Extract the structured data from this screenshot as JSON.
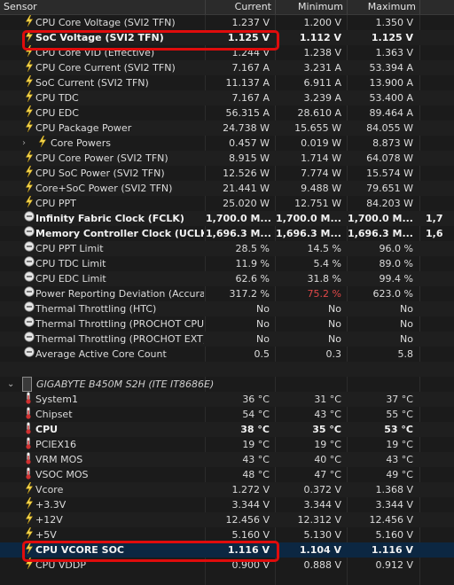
{
  "header": {
    "sensor": "Sensor",
    "current": "Current",
    "minimum": "Minimum",
    "maximum": "Maximum"
  },
  "rows1": [
    {
      "name": "CPU Core Voltage (SVI2 TFN)",
      "cur": "1.237 V",
      "min": "1.200 V",
      "max": "1.350 V",
      "icon": "bolt-icon"
    },
    {
      "name": "SoC Voltage (SVI2 TFN)",
      "cur": "1.125 V",
      "min": "1.112 V",
      "max": "1.125 V",
      "icon": "bolt-icon",
      "bold": true
    },
    {
      "name": "CPU Core VID (Effective)",
      "cur": "1.244 V",
      "min": "1.238 V",
      "max": "1.363 V",
      "icon": "bolt-icon"
    },
    {
      "name": "CPU Core Current (SVI2 TFN)",
      "cur": "7.167 A",
      "min": "3.231 A",
      "max": "53.394 A",
      "icon": "bolt-icon"
    },
    {
      "name": "SoC Current (SVI2 TFN)",
      "cur": "11.137 A",
      "min": "6.911 A",
      "max": "13.900 A",
      "icon": "bolt-icon"
    },
    {
      "name": "CPU TDC",
      "cur": "7.167 A",
      "min": "3.239 A",
      "max": "53.400 A",
      "icon": "bolt-icon"
    },
    {
      "name": "CPU EDC",
      "cur": "56.315 A",
      "min": "28.610 A",
      "max": "89.464 A",
      "icon": "bolt-icon"
    },
    {
      "name": "CPU Package Power",
      "cur": "24.738 W",
      "min": "15.655 W",
      "max": "84.055 W",
      "icon": "bolt-icon"
    },
    {
      "name": "Core Powers",
      "cur": "0.457 W",
      "min": "0.019 W",
      "max": "8.873 W",
      "icon": "bolt-icon",
      "indent": true
    },
    {
      "name": "CPU Core Power (SVI2 TFN)",
      "cur": "8.915 W",
      "min": "1.714 W",
      "max": "64.078 W",
      "icon": "bolt-icon"
    },
    {
      "name": "CPU SoC Power (SVI2 TFN)",
      "cur": "12.526 W",
      "min": "7.774 W",
      "max": "15.574 W",
      "icon": "bolt-icon"
    },
    {
      "name": "Core+SoC Power (SVI2 TFN)",
      "cur": "21.441 W",
      "min": "9.488 W",
      "max": "79.651 W",
      "icon": "bolt-icon"
    },
    {
      "name": "CPU PPT",
      "cur": "25.020 W",
      "min": "12.751 W",
      "max": "84.203 W",
      "icon": "bolt-icon"
    },
    {
      "name": "Infinity Fabric Clock (FCLK)",
      "cur": "1,700.0 M...",
      "min": "1,700.0 M...",
      "max": "1,700.0 M...",
      "avg": "1,7",
      "icon": "clock-icon",
      "bold": true
    },
    {
      "name": "Memory Controller Clock (UCLK)",
      "cur": "1,696.3 M...",
      "min": "1,696.3 M...",
      "max": "1,696.3 M...",
      "avg": "1,6",
      "icon": "clock-icon",
      "bold": true
    },
    {
      "name": "CPU PPT Limit",
      "cur": "28.5 %",
      "min": "14.5 %",
      "max": "96.0 %",
      "icon": "clock-icon"
    },
    {
      "name": "CPU TDC Limit",
      "cur": "11.9 %",
      "min": "5.4 %",
      "max": "89.0 %",
      "icon": "clock-icon"
    },
    {
      "name": "CPU EDC Limit",
      "cur": "62.6 %",
      "min": "31.8 %",
      "max": "99.4 %",
      "icon": "clock-icon"
    },
    {
      "name": "Power Reporting Deviation (Accuracy)",
      "cur": "317.2 %",
      "min": "75.2 %",
      "max": "623.0 %",
      "icon": "clock-icon",
      "minRed": true
    },
    {
      "name": "Thermal Throttling (HTC)",
      "cur": "No",
      "min": "No",
      "max": "No",
      "icon": "clock-icon"
    },
    {
      "name": "Thermal Throttling (PROCHOT CPU)",
      "cur": "No",
      "min": "No",
      "max": "No",
      "icon": "clock-icon"
    },
    {
      "name": "Thermal Throttling (PROCHOT EXT)",
      "cur": "No",
      "min": "No",
      "max": "No",
      "icon": "clock-icon"
    },
    {
      "name": "Average Active Core Count",
      "cur": "0.5",
      "min": "0.3",
      "max": "5.8",
      "icon": "clock-icon"
    }
  ],
  "group": {
    "name": "GIGABYTE B450M S2H (ITE IT8686E)"
  },
  "rows2": [
    {
      "name": "System1",
      "cur": "36 °C",
      "min": "31 °C",
      "max": "37 °C",
      "icon": "thermometer-icon"
    },
    {
      "name": "Chipset",
      "cur": "54 °C",
      "min": "43 °C",
      "max": "55 °C",
      "icon": "thermometer-icon"
    },
    {
      "name": "CPU",
      "cur": "38 °C",
      "min": "35 °C",
      "max": "53 °C",
      "icon": "thermometer-icon",
      "bold": true
    },
    {
      "name": "PCIEX16",
      "cur": "19 °C",
      "min": "19 °C",
      "max": "19 °C",
      "icon": "thermometer-icon"
    },
    {
      "name": "VRM MOS",
      "cur": "43 °C",
      "min": "40 °C",
      "max": "43 °C",
      "icon": "thermometer-icon"
    },
    {
      "name": "VSOC MOS",
      "cur": "48 °C",
      "min": "47 °C",
      "max": "49 °C",
      "icon": "thermometer-icon"
    },
    {
      "name": "Vcore",
      "cur": "1.272 V",
      "min": "0.372 V",
      "max": "1.368 V",
      "icon": "bolt-icon"
    },
    {
      "name": "+3.3V",
      "cur": "3.344 V",
      "min": "3.344 V",
      "max": "3.344 V",
      "icon": "bolt-icon"
    },
    {
      "name": "+12V",
      "cur": "12.456 V",
      "min": "12.312 V",
      "max": "12.456 V",
      "icon": "bolt-icon"
    },
    {
      "name": "+5V",
      "cur": "5.160 V",
      "min": "5.130 V",
      "max": "5.160 V",
      "icon": "bolt-icon"
    },
    {
      "name": "CPU VCORE SOC",
      "cur": "1.116 V",
      "min": "1.104 V",
      "max": "1.116 V",
      "icon": "bolt-icon",
      "bold": true,
      "selected": true
    },
    {
      "name": "CPU VDDP",
      "cur": "0.900 V",
      "min": "0.888 V",
      "max": "0.912 V",
      "icon": "bolt-icon"
    }
  ]
}
